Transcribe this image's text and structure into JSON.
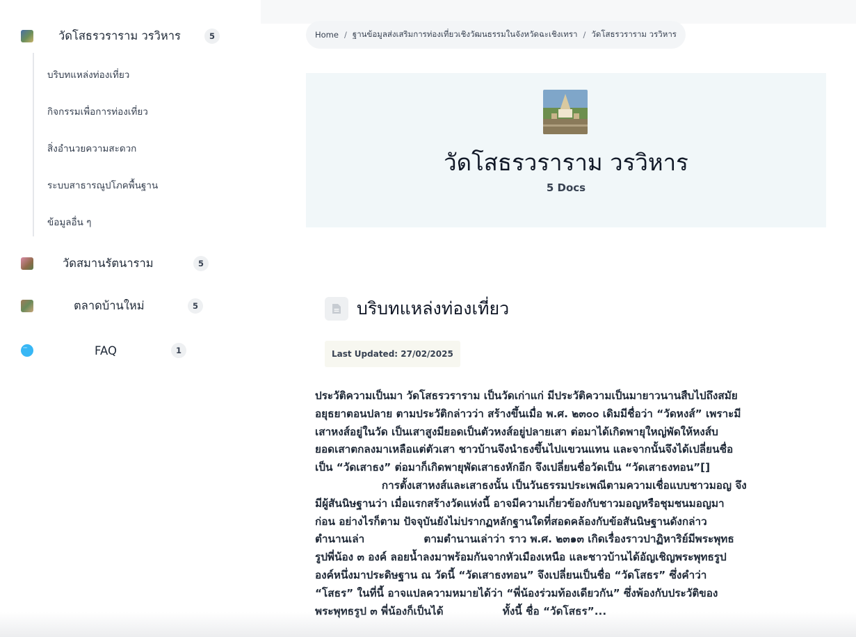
{
  "sidebar": {
    "docs": [
      {
        "title": "วัดโสธรวราราม วรวิหาร",
        "count": "5",
        "thumb_color": "#6b8e5a"
      },
      {
        "title": "วัดสมานรัตนาราม",
        "count": "5",
        "thumb_color": "#c46a8a"
      },
      {
        "title": "ตลาดบ้านใหม่",
        "count": "5",
        "thumb_color": "#8a6a4a"
      },
      {
        "title": "FAQ",
        "count": "1",
        "thumb_color": "#38b7f5"
      }
    ],
    "subitems": [
      "บริบทแหล่งท่องเที่ยว",
      "กิจกรรมเพื่อการท่องเที่ยว",
      "สิ่งอำนวยความสะดวก",
      "ระบบสาธารณูปโภคพื้นฐาน",
      "ข้อมูลอื่น ๆ"
    ]
  },
  "breadcrumb": {
    "home": "Home",
    "sep1": "/",
    "parent": "ฐานข้อมูลส่งเสริมการท่องเที่ยวเชิงวัฒนธรรมในจังหวัดฉะเชิงเทรา",
    "sep2": "/",
    "current": "วัดโสธรวราราม วรวิหาร"
  },
  "hero": {
    "title": "วัดโสธรวราราม วรวิหาร",
    "count": "5 Docs"
  },
  "section": {
    "title": "บริบทแหล่งท่องเที่ยว",
    "updated": "Last Updated: 27/02/2025",
    "lines": [
      "ประวัติความเป็นมา วัดโสธรวราราม เป็นวัดเก่าแก่ มีประวัติความเป็นมายาวนานสืบไปถึงสมัย",
      "อยุธยาตอนปลาย ตามประวัติกล่าวว่า สร้างขึ้นเมื่อ พ.ศ. ๒๓๐๐ เดิมมีชื่อว่า “วัดหงส์” เพราะมี",
      "เสาหงส์อยู่ในวัด เป็นเสาสูงมียอดเป็นตัวหงส์อยู่ปลายเสา ต่อมาได้เกิดพายุใหญ่พัดให้หงส์บ",
      "ยอดเสาตกลงมาเหลือแต่ตัวเสา ชาวบ้านจึงนำธงขึ้นไปแขวนแทน และจากนั้นจึงได้เปลี่ยนชื่อ",
      "เป็น “วัดเสาธง” ต่อมาก็เกิดพายุพัดเสาธงหักอีก จึงเปลี่ยนชื่อวัดเป็น “วัดเสาธงทอน”[]",
      "                  การตั้งเสาหงส์และเสาธงนั้น เป็นวันธรรมประเพณีตามความเชื่อแบบชาวมอญ จึง",
      "มีผู้สันนิษฐานว่า เมื่อแรกสร้างวัดแห่งนี้ อาจมีความเกี่ยวข้องกับชาวมอญหรือชุมชนมอญมา",
      "ก่อน อย่างไรก็ตาม ปัจจุบันยังไม่ปรากฏหลักฐานใดที่สอดคล้องกับข้อสันนิษฐานดังกล่าว",
      "ตำนานเล่า                ตามตำนานเล่าว่า ราว พ.ศ. ๒๓๑๓ เกิดเรื่องราวปาฏิหาริย์มีพระพุทธ",
      "รูปพี่น้อง ๓ องค์ ลอยน้ำลงมาพร้อมกันจากหัวเมืองเหนือ และชาวบ้านได้อัญเชิญพระพุทธรูป",
      "องค์หนึ่งมาประดิษฐาน ณ วัดนี้ “วัดเสาธงทอน” จึงเปลี่ยนเป็นชื่อ “วัดโสธร” ซึ่งคำว่า",
      "“โสธร” ในที่นี้ อาจแปลความหมายได้ว่า “พี่น้องร่วมท้องเดียวกัน” ซึ่งพ้องกับประวัติของ",
      "พระพุทธรูป ๓ พี่น้องก็เป็นได้                ทั้งนี้ ชื่อ “วัดโสธร”..."
    ]
  }
}
